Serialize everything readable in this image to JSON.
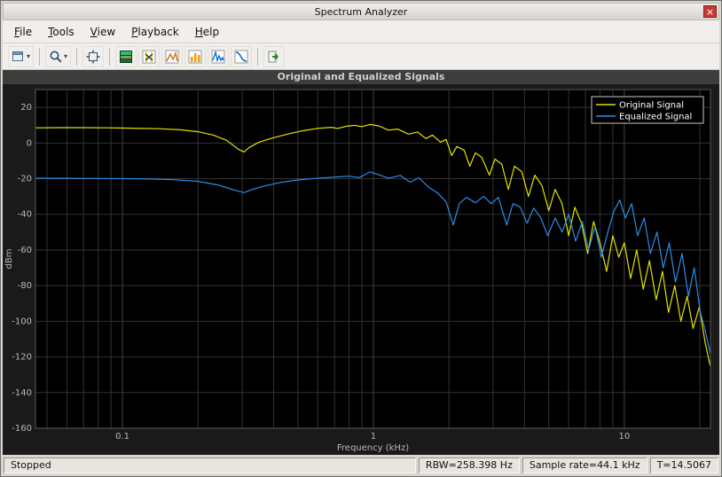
{
  "window": {
    "title": "Spectrum Analyzer",
    "close_label": "×"
  },
  "menu": {
    "items": [
      {
        "accel": "F",
        "rest": "ile"
      },
      {
        "accel": "T",
        "rest": "ools"
      },
      {
        "accel": "V",
        "rest": "iew"
      },
      {
        "accel": "P",
        "rest": "layback"
      },
      {
        "accel": "H",
        "rest": "elp"
      }
    ]
  },
  "toolbar": {
    "buttons": [
      {
        "icon": "scope-configuration-icon"
      },
      {
        "icon": "zoom-icon"
      },
      {
        "icon": "fit-to-view-icon"
      },
      {
        "icon": "spectrogram-icon"
      },
      {
        "icon": "cursor-measurements-icon"
      },
      {
        "icon": "peak-finder-icon"
      },
      {
        "icon": "channel-measurements-icon"
      },
      {
        "icon": "distortion-measurements-icon"
      },
      {
        "icon": "ccdf-measurements-icon"
      },
      {
        "icon": "step-forward-icon"
      }
    ]
  },
  "status": {
    "state": "Stopped",
    "rbw": "RBW=258.398 Hz",
    "sample_rate": "Sample rate=44.1 kHz",
    "time": "T=14.5067"
  },
  "chart_data": {
    "type": "line",
    "title": "Original and Equalized Signals",
    "xlabel": "Frequency (kHz)",
    "ylabel": "dBm",
    "xscale": "log",
    "xlim": [
      0.045,
      22.05
    ],
    "ylim": [
      -160,
      30
    ],
    "yticks": [
      20,
      0,
      -20,
      -40,
      -60,
      -80,
      -100,
      -120,
      -140,
      -160
    ],
    "xticks": [
      0.1,
      1,
      10
    ],
    "xtick_labels": [
      "0.1",
      "1",
      "10"
    ],
    "grid": true,
    "background": "#000000",
    "grid_color": "#333333",
    "grid_major_color": "#454545",
    "tick_color": "#b8b8b8",
    "legend_position": "top-right",
    "series": [
      {
        "name": "Original Signal",
        "color": "#e3e300",
        "points": [
          [
            0.045,
            8.5
          ],
          [
            0.055,
            8.6
          ],
          [
            0.07,
            8.6
          ],
          [
            0.09,
            8.5
          ],
          [
            0.11,
            8.3
          ],
          [
            0.14,
            8.0
          ],
          [
            0.17,
            7.4
          ],
          [
            0.2,
            6.3
          ],
          [
            0.23,
            4.5
          ],
          [
            0.26,
            1.5
          ],
          [
            0.29,
            -3.5
          ],
          [
            0.305,
            -5.0
          ],
          [
            0.32,
            -2.5
          ],
          [
            0.35,
            0.5
          ],
          [
            0.4,
            3.0
          ],
          [
            0.46,
            5.2
          ],
          [
            0.52,
            6.8
          ],
          [
            0.6,
            8.2
          ],
          [
            0.68,
            8.8
          ],
          [
            0.72,
            8.2
          ],
          [
            0.78,
            9.4
          ],
          [
            0.84,
            9.9
          ],
          [
            0.9,
            9.2
          ],
          [
            0.97,
            10.4
          ],
          [
            1.05,
            9.6
          ],
          [
            1.15,
            7.2
          ],
          [
            1.25,
            7.8
          ],
          [
            1.38,
            5.0
          ],
          [
            1.5,
            6.2
          ],
          [
            1.62,
            2.5
          ],
          [
            1.72,
            4.5
          ],
          [
            1.85,
            0.5
          ],
          [
            1.95,
            2.0
          ],
          [
            2.05,
            -7.0
          ],
          [
            2.15,
            -2.0
          ],
          [
            2.3,
            -4.0
          ],
          [
            2.42,
            -13.0
          ],
          [
            2.55,
            -5.5
          ],
          [
            2.7,
            -8.0
          ],
          [
            2.9,
            -18.0
          ],
          [
            3.05,
            -9.0
          ],
          [
            3.25,
            -12.0
          ],
          [
            3.45,
            -26.0
          ],
          [
            3.65,
            -13.0
          ],
          [
            3.9,
            -16.0
          ],
          [
            4.15,
            -30.0
          ],
          [
            4.4,
            -18.0
          ],
          [
            4.7,
            -24.0
          ],
          [
            5.0,
            -38.0
          ],
          [
            5.3,
            -26.0
          ],
          [
            5.65,
            -34.0
          ],
          [
            6.0,
            -52.0
          ],
          [
            6.35,
            -36.0
          ],
          [
            6.75,
            -45.0
          ],
          [
            7.15,
            -62.0
          ],
          [
            7.55,
            -44.0
          ],
          [
            8.0,
            -56.0
          ],
          [
            8.5,
            -72.0
          ],
          [
            9.0,
            -52.0
          ],
          [
            9.5,
            -64.0
          ],
          [
            10.0,
            -56.0
          ],
          [
            10.6,
            -76.0
          ],
          [
            11.2,
            -60.0
          ],
          [
            11.9,
            -82.0
          ],
          [
            12.6,
            -66.0
          ],
          [
            13.4,
            -88.0
          ],
          [
            14.2,
            -72.0
          ],
          [
            15.0,
            -95.0
          ],
          [
            15.9,
            -80.0
          ],
          [
            16.8,
            -100.0
          ],
          [
            17.8,
            -86.0
          ],
          [
            18.8,
            -104.0
          ],
          [
            19.9,
            -92.0
          ],
          [
            21.0,
            -112.0
          ],
          [
            22.0,
            -125.0
          ]
        ]
      },
      {
        "name": "Equalized Signal",
        "color": "#2d8ce8",
        "points": [
          [
            0.045,
            -19.8
          ],
          [
            0.06,
            -19.8
          ],
          [
            0.08,
            -19.9
          ],
          [
            0.1,
            -20.0
          ],
          [
            0.13,
            -20.2
          ],
          [
            0.16,
            -20.6
          ],
          [
            0.2,
            -21.5
          ],
          [
            0.24,
            -23.5
          ],
          [
            0.28,
            -26.5
          ],
          [
            0.305,
            -27.8
          ],
          [
            0.33,
            -26.0
          ],
          [
            0.37,
            -24.0
          ],
          [
            0.42,
            -22.3
          ],
          [
            0.48,
            -21.0
          ],
          [
            0.55,
            -20.2
          ],
          [
            0.63,
            -19.6
          ],
          [
            0.72,
            -19.0
          ],
          [
            0.8,
            -18.6
          ],
          [
            0.88,
            -19.4
          ],
          [
            0.97,
            -16.2
          ],
          [
            1.05,
            -17.8
          ],
          [
            1.15,
            -19.8
          ],
          [
            1.28,
            -18.2
          ],
          [
            1.4,
            -22.0
          ],
          [
            1.52,
            -19.5
          ],
          [
            1.65,
            -24.5
          ],
          [
            1.8,
            -28.0
          ],
          [
            1.95,
            -33.0
          ],
          [
            2.08,
            -46.0
          ],
          [
            2.2,
            -34.0
          ],
          [
            2.35,
            -30.5
          ],
          [
            2.55,
            -33.5
          ],
          [
            2.75,
            -30.0
          ],
          [
            2.95,
            -34.0
          ],
          [
            3.15,
            -30.5
          ],
          [
            3.4,
            -46.0
          ],
          [
            3.6,
            -34.0
          ],
          [
            3.85,
            -36.0
          ],
          [
            4.1,
            -45.0
          ],
          [
            4.35,
            -36.5
          ],
          [
            4.65,
            -42.0
          ],
          [
            4.95,
            -52.0
          ],
          [
            5.3,
            -42.0
          ],
          [
            5.65,
            -50.0
          ],
          [
            6.0,
            -40.0
          ],
          [
            6.4,
            -55.0
          ],
          [
            6.8,
            -44.0
          ],
          [
            7.2,
            -60.0
          ],
          [
            7.65,
            -47.0
          ],
          [
            8.1,
            -64.0
          ],
          [
            8.6,
            -50.0
          ],
          [
            9.1,
            -38.0
          ],
          [
            9.6,
            -32.0
          ],
          [
            10.1,
            -42.0
          ],
          [
            10.7,
            -34.0
          ],
          [
            11.3,
            -52.0
          ],
          [
            12.0,
            -42.0
          ],
          [
            12.7,
            -62.0
          ],
          [
            13.5,
            -50.0
          ],
          [
            14.3,
            -70.0
          ],
          [
            15.1,
            -56.0
          ],
          [
            16.0,
            -78.0
          ],
          [
            17.0,
            -62.0
          ],
          [
            18.0,
            -86.0
          ],
          [
            19.0,
            -70.0
          ],
          [
            20.1,
            -95.0
          ],
          [
            21.0,
            -105.0
          ],
          [
            22.0,
            -118.0
          ]
        ]
      }
    ]
  }
}
